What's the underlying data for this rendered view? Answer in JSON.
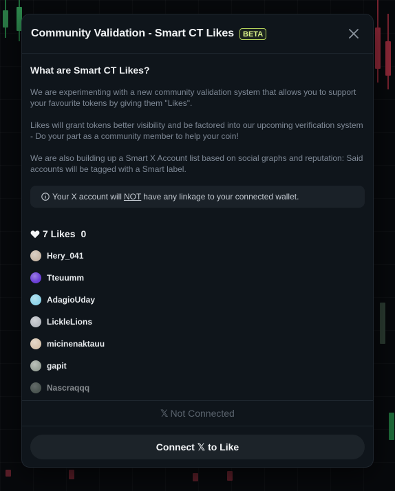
{
  "header": {
    "title": "Community Validation - Smart CT Likes",
    "badge": "BETA"
  },
  "body": {
    "heading": "What are Smart CT Likes?",
    "paragraphs": [
      "We are experimenting with a new community validation system that allows you to support your favourite tokens by giving them \"Likes\".",
      "Likes will grant tokens better visibility and be factored into our upcoming verification system - Do your part as a community member to help your coin!",
      "We are also building up a Smart X Account list based on social graphs and reputation: Said accounts will be tagged with a Smart label."
    ],
    "notice": {
      "before": "Your X account will",
      "emphasis": "NOT",
      "after": "have any linkage to your connected wallet."
    }
  },
  "likes": {
    "count_label": "7 Likes",
    "secondary": "0",
    "users": [
      {
        "name": "Hery_041",
        "avatar_color": "#c9b9a8"
      },
      {
        "name": "Tteuumm",
        "avatar_color": "#6b3fd6"
      },
      {
        "name": "AdagioUday",
        "avatar_color": "#8fd3e8"
      },
      {
        "name": "LickleLions",
        "avatar_color": "#b8bcc2"
      },
      {
        "name": "micinenaktauu",
        "avatar_color": "#d8c5b0"
      },
      {
        "name": "gapit",
        "avatar_color": "#9aa39a"
      },
      {
        "name": "Nascraqqq",
        "avatar_color": "#7f8c80"
      }
    ]
  },
  "status": {
    "x_symbol": "𝕏",
    "text": "Not Connected"
  },
  "connect_button": {
    "before": "Connect",
    "x_symbol": "𝕏",
    "after": "to Like"
  },
  "colors": {
    "modal_bg": "#0f151b",
    "badge_accent": "#d8f08a",
    "muted_text": "#7d8794"
  }
}
